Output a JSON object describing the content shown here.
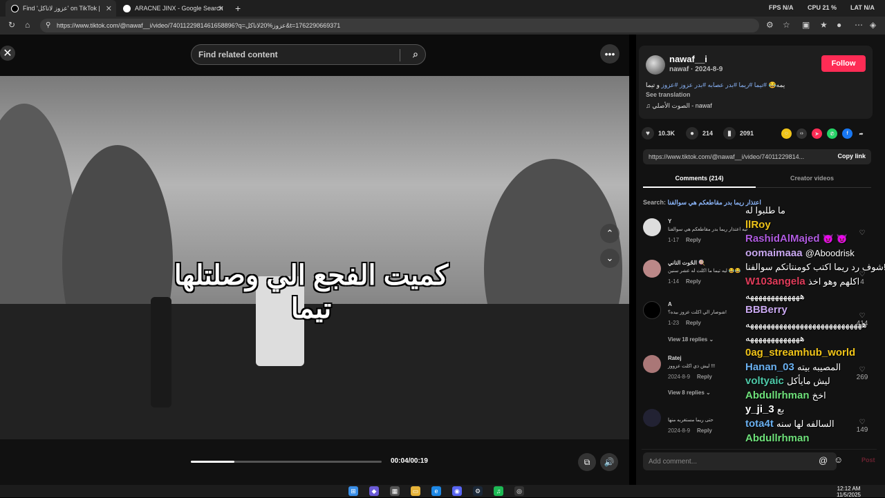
{
  "browser": {
    "tabs": [
      {
        "title": "Find 'عزوز لاتاكل' on TikTok |",
        "active": true
      },
      {
        "title": "ARACNE JINX - Google Search",
        "active": false
      }
    ],
    "new_tab": "+",
    "perf": {
      "fps_label": "FPS",
      "fps_value": "N/A",
      "cpu_label": "CPU",
      "cpu_value": "21 %",
      "lat_label": "LAT",
      "lat_value": "N/A"
    },
    "url": "https://www.tiktok.com/@nawaf__i/video/7401122981461658896?q=عزوز%20لاتاكل&t=1762290669371"
  },
  "player": {
    "search_placeholder": "Find related content",
    "caption_line1": "كميت الفجع الي وصلتلها",
    "caption_line2": "تيما",
    "time": "00:04/00:19",
    "progress": 0.23
  },
  "post": {
    "username": "nawaf__i",
    "subline": "nawaf · 2024-8-9",
    "follow_label": "Follow",
    "desc_prefix": "يمه😂 ",
    "desc_tags": "#تيما #ريما #بدر عصابه #بدر عزوز #عزوز",
    "desc_suffix": " و تيما",
    "see_translation": "See translation",
    "music": "♫ الصوت الأصلي - nawaf",
    "likes": "10.3K",
    "comments_count": "214",
    "saves": "2091",
    "link": "https://www.tiktok.com/@nawaf__i/video/74011229814...",
    "copy_link": "Copy link",
    "tab_comments": "Comments (214)",
    "tab_creator": "Creator videos",
    "search_label": "Search:",
    "search_term": "اعتذار ريما بدر مقاطعكم هي سوالفنا"
  },
  "comments": [
    {
      "name": "Y",
      "text": "ليه اعتذار ريما بدر مقاطعكم هي سوالفنا",
      "date": "1-17",
      "reply": "Reply"
    },
    {
      "name": "الحُوت التاني 🍭",
      "text": "ليه تيما ما اكلت له عشر سنين 😂😂",
      "date": "1-14",
      "reply": "Reply"
    },
    {
      "name": "A",
      "text": "شوصار الي اكلت عزوز بيده؟!",
      "date": "1-23",
      "reply": "Reply"
    },
    {
      "name": "Ratej",
      "text": "ليش ذي اكلت عزووز !!!",
      "date": "2024-8-9",
      "reply": "Reply"
    },
    {
      "name": "",
      "text": "حتى ريما مستغربه منها",
      "date": "2024-8-9",
      "reply": "Reply"
    }
  ],
  "view_replies": [
    "View 18 replies ⌄",
    "View 8 replies ⌄"
  ],
  "add_comment": {
    "placeholder": "Add comment...",
    "post_label": "Post"
  },
  "chat": [
    {
      "user": "",
      "msg": "ما طلبوا له",
      "color": "#ffffff"
    },
    {
      "user": "llRoy",
      "msg": "",
      "color": "#f0c419"
    },
    {
      "user": "RashidAlMajed",
      "msg": "😈 😈",
      "color": "#b05be0"
    },
    {
      "user": "oomaimaaa",
      "msg": "@Aboodrisk",
      "color": "#c9a8f0"
    },
    {
      "user": "",
      "msg": "شوف رد ريما اكتب كومنتاتكم سوالفنا!!!!",
      "color": "#ffffff"
    },
    {
      "user": "W103angela",
      "msg": "اكلهم وهو اخذ",
      "color": "#e03c5a"
    },
    {
      "user": "",
      "msg": "هههههههههههههه",
      "color": "#ffffff"
    },
    {
      "user": "BBBerry",
      "msg": "",
      "color": "#c9a8f0"
    },
    {
      "user": "",
      "msg": "ههههههههههههههههههههههههههههه",
      "color": "#ffffff"
    },
    {
      "user": "",
      "msg": "هههههههههههههه",
      "color": "#ffffff"
    },
    {
      "user": "0ag_streamhub_world",
      "msg": "",
      "color": "#f0c419"
    },
    {
      "user": "Hanan_03",
      "msg": "المصيبه بيته",
      "color": "#6ab0f0"
    },
    {
      "user": "voltyaic",
      "msg": "ليش مايأكل",
      "color": "#4ec9a8"
    },
    {
      "user": "Abdullrhman",
      "msg": "اخخ",
      "color": "#6ee07a"
    },
    {
      "user": "y_ji_3",
      "msg": "بع",
      "color": "#ffffff"
    },
    {
      "user": "tota4t",
      "msg": "السالفه لها سنه",
      "color": "#6ab0f0"
    },
    {
      "user": "Abdullrhman",
      "msg": "",
      "color": "#6ee07a"
    }
  ],
  "heart_counts": [
    "4",
    "414",
    "269",
    "149"
  ],
  "clock": {
    "time": "12:12 AM",
    "date": "11/5/2025"
  },
  "colors": {
    "accent": "#fe2c55",
    "link": "#8ab4f8"
  }
}
